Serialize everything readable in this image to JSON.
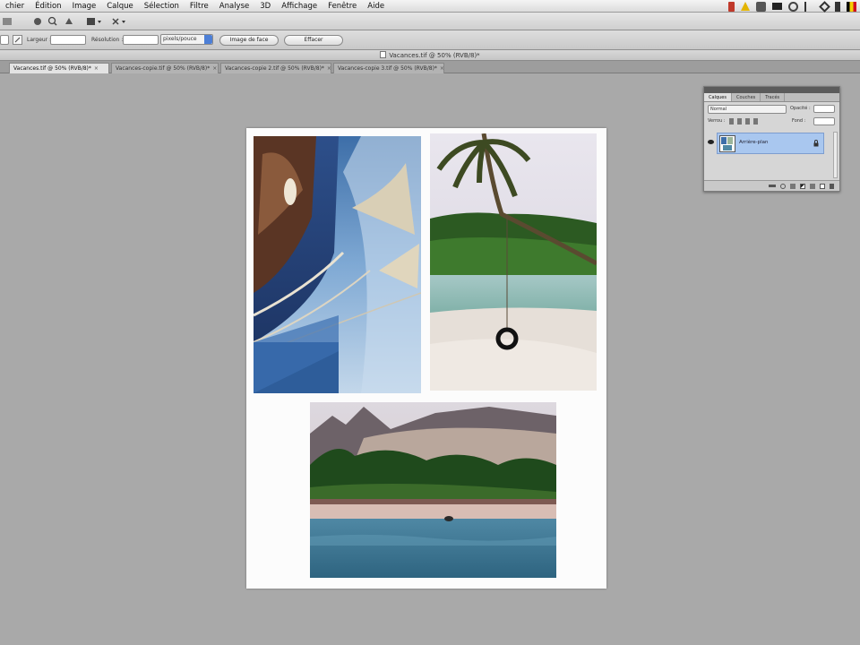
{
  "menubar": {
    "items": [
      "chier",
      "Édition",
      "Image",
      "Calque",
      "Sélection",
      "Filtre",
      "Analyse",
      "3D",
      "Affichage",
      "Fenêtre",
      "Aide"
    ]
  },
  "optionsbar": {
    "largeur_label": "Largeur :",
    "resolution_label": "Résolution :",
    "unit_select": "pixels/pouce",
    "front_image_button": "Image de face",
    "clear_button": "Effacer"
  },
  "document": {
    "title": "Vacances.tif @ 50% (RVB/8)*"
  },
  "tabs": [
    {
      "label": "Vacances.tif @ 50% (RVB/8)*"
    },
    {
      "label": "Vacances-copie.tif @ 50% (RVB/8)*"
    },
    {
      "label": "Vacances-copie 2.tif @ 50% (RVB/8)*"
    },
    {
      "label": "Vacances-copie 3.tif @ 50% (RVB/8)*"
    }
  ],
  "layers_panel": {
    "tabs": [
      "Calques",
      "Couches",
      "Tracés"
    ],
    "blend_mode": "Normal",
    "opacity_label": "Opacité :",
    "lock_label": "Verrou :",
    "fill_label": "Fond :",
    "layer_name": "Arrière-plan"
  },
  "colors": {
    "accent": "#4d7fd6",
    "selected_layer": "#a9c7ef",
    "canvas_bg": "#a9a9a9"
  }
}
